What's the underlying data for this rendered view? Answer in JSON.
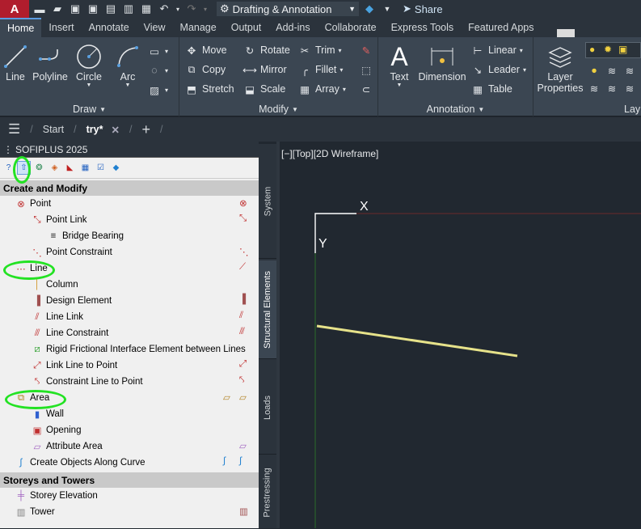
{
  "qat": {
    "logo": "A",
    "workspace": "Drafting & Annotation",
    "share": "Share"
  },
  "ribbon_tabs": [
    "Home",
    "Insert",
    "Annotate",
    "View",
    "Manage",
    "Output",
    "Add-ins",
    "Collaborate",
    "Express Tools",
    "Featured Apps"
  ],
  "draw": {
    "title": "Draw",
    "line": "Line",
    "polyline": "Polyline",
    "circle": "Circle",
    "arc": "Arc"
  },
  "modify": {
    "title": "Modify",
    "move": "Move",
    "rotate": "Rotate",
    "trim": "Trim",
    "copy": "Copy",
    "mirror": "Mirror",
    "fillet": "Fillet",
    "stretch": "Stretch",
    "scale": "Scale",
    "array": "Array"
  },
  "annotation": {
    "title": "Annotation",
    "text": "Text",
    "dimension": "Dimension",
    "linear": "Linear",
    "leader": "Leader",
    "table": "Table"
  },
  "layers": {
    "layer_properties_line1": "Layer",
    "layer_properties_line2": "Properties",
    "title_partial": "Lay"
  },
  "doc_tabs": {
    "start": "Start",
    "current": "try*"
  },
  "sidebar": {
    "title": "SOFIPLUS 2025",
    "section1": "Create and Modify",
    "items": [
      "Point",
      "Point Link",
      "Bridge Bearing",
      "Point Constraint",
      "Line",
      "Column",
      "Design Element",
      "Line Link",
      "Line Constraint",
      "Rigid Frictional Interface Element between Lines",
      "Link Line to Point",
      "Constraint Line to Point",
      "Area",
      "Wall",
      "Opening",
      "Attribute Area",
      "Create Objects Along Curve"
    ],
    "section2": "Storeys and Towers",
    "items2": [
      "Storey Elevation",
      "Tower"
    ]
  },
  "side_tabs": [
    "System",
    "Structural Elements",
    "Loads",
    "Prestressing"
  ],
  "viewport": {
    "label": "[−][Top][2D Wireframe]",
    "axis_x": "X",
    "axis_y": "Y"
  },
  "colors": {
    "annotation_circle": "#23e223",
    "drawn_line": "#e6e28a",
    "ucs_red": "#7a2a2a",
    "ucs_green": "#2a7a2a"
  }
}
